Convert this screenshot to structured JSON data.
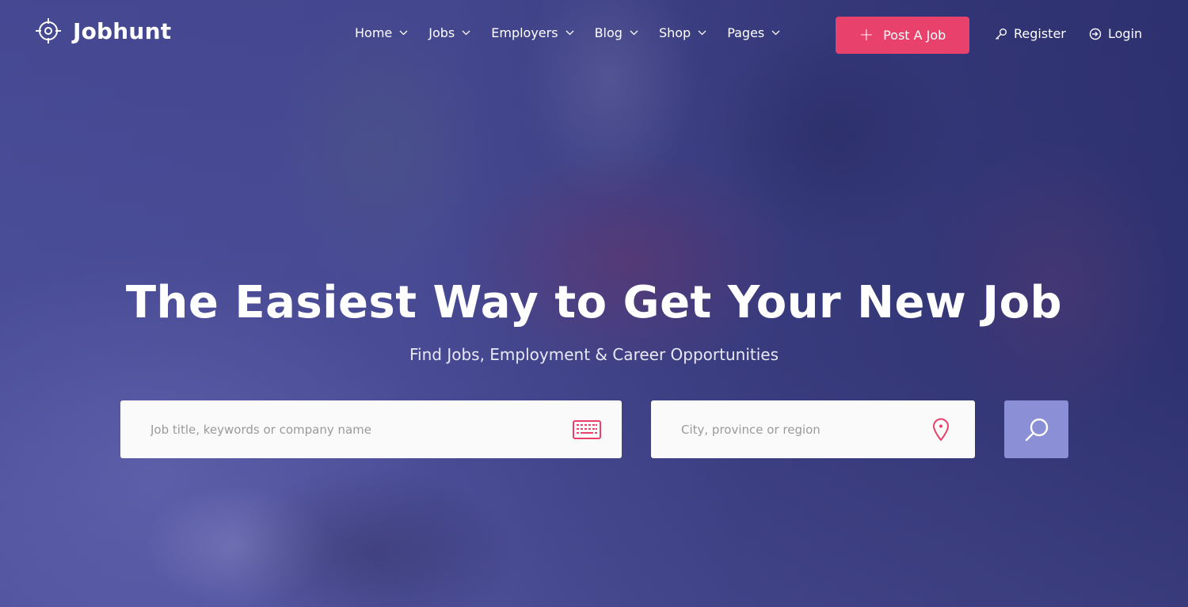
{
  "brand": {
    "name": "Jobhunt",
    "logo_icon": "crosshair-target-icon"
  },
  "nav": {
    "items": [
      {
        "label": "Home",
        "has_dropdown": true
      },
      {
        "label": "Jobs",
        "has_dropdown": true
      },
      {
        "label": "Employers",
        "has_dropdown": true
      },
      {
        "label": "Blog",
        "has_dropdown": true
      },
      {
        "label": "Shop",
        "has_dropdown": true
      },
      {
        "label": "Pages",
        "has_dropdown": true
      }
    ],
    "post_job": {
      "label": "Post A Job",
      "icon": "plus-icon"
    },
    "register": {
      "label": "Register",
      "icon": "key-icon"
    },
    "login": {
      "label": "Login",
      "icon": "login-icon"
    }
  },
  "hero": {
    "title": "The Easiest Way to Get Your New Job",
    "subtitle": "Find Jobs, Employment & Career Opportunities"
  },
  "search": {
    "keyword": {
      "value": "",
      "placeholder": "Job title, keywords or company name",
      "icon": "keyboard-icon"
    },
    "location": {
      "value": "",
      "placeholder": "City, province or region",
      "icon": "map-pin-icon"
    },
    "submit_icon": "search-icon"
  },
  "colors": {
    "accent_pink": "#e8416b",
    "search_button": "#8a8fd6",
    "hero_overlay": "#3d3f86",
    "input_bg": "#fafafa"
  }
}
